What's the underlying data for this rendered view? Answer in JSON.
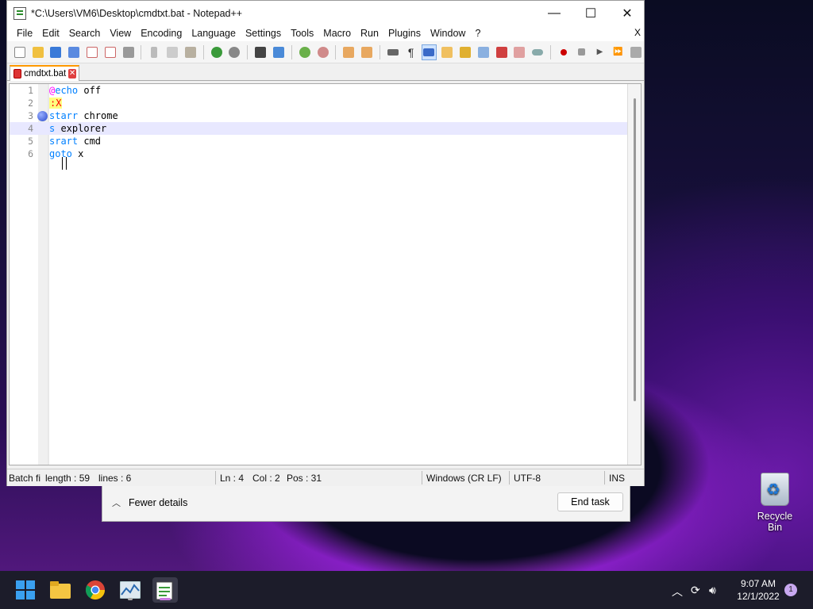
{
  "window": {
    "title": "*C:\\Users\\VM6\\Desktop\\cmdtxt.bat - Notepad++",
    "minimize": "—",
    "maximize": "☐",
    "close": "✕"
  },
  "menu": {
    "items": [
      "File",
      "Edit",
      "Search",
      "View",
      "Encoding",
      "Language",
      "Settings",
      "Tools",
      "Macro",
      "Run",
      "Plugins",
      "Window",
      "?"
    ],
    "close_doc": "X"
  },
  "toolbar_icons": [
    "new-file-icon",
    "open-file-icon",
    "save-icon",
    "save-all-icon",
    "close-icon",
    "close-all-icon",
    "print-icon",
    "cut-icon",
    "copy-icon",
    "paste-icon",
    "undo-icon",
    "redo-icon",
    "find-icon",
    "replace-icon",
    "zoom-in-icon",
    "zoom-out-icon",
    "sync-vertical-icon",
    "sync-horizontal-icon",
    "word-wrap-icon",
    "show-all-chars-icon",
    "indent-guide-icon",
    "doc-map-icon",
    "function-list-icon",
    "folder-workspace-icon",
    "monitoring-icon",
    "record-macro-icon",
    "stop-record-icon",
    "play-macro-icon",
    "run-macro-multiple-icon",
    "save-macro-icon"
  ],
  "tab": {
    "label": "cmdtxt.bat",
    "close": "✕"
  },
  "editor": {
    "lines": [
      {
        "num": "1",
        "parts": [
          {
            "t": "@",
            "c": "at"
          },
          {
            "t": "echo",
            "c": "kw"
          },
          {
            "t": " off",
            "c": ""
          }
        ]
      },
      {
        "num": "2",
        "parts": [
          {
            "t": ":X",
            "c": "lbl"
          }
        ]
      },
      {
        "num": "3",
        "parts": [
          {
            "t": "starr",
            "c": "kw"
          },
          {
            "t": " chrome",
            "c": ""
          }
        ],
        "bookmark": true
      },
      {
        "num": "4",
        "parts": [
          {
            "t": "s",
            "c": "kw"
          },
          {
            "t": " explorer",
            "c": ""
          }
        ],
        "current": true
      },
      {
        "num": "5",
        "parts": [
          {
            "t": "srart",
            "c": "kw"
          },
          {
            "t": " cmd",
            "c": ""
          }
        ]
      },
      {
        "num": "6",
        "parts": [
          {
            "t": "goto",
            "c": "kw"
          },
          {
            "t": " x",
            "c": ""
          }
        ]
      }
    ]
  },
  "status": {
    "type": "Batch fi",
    "length": "length : 59",
    "lines": "lines : 6",
    "ln": "Ln : 4",
    "col": "Col : 2",
    "pos": "Pos : 31",
    "eol": "Windows (CR LF)",
    "encoding": "UTF-8",
    "mode": "INS"
  },
  "task_manager": {
    "fewer_details": "Fewer details",
    "end_task": "End task"
  },
  "desktop": {
    "recycle_bin": "Recycle Bin"
  },
  "taskbar": {
    "time": "9:07 AM",
    "date": "12/1/2022",
    "notifications": "1"
  }
}
